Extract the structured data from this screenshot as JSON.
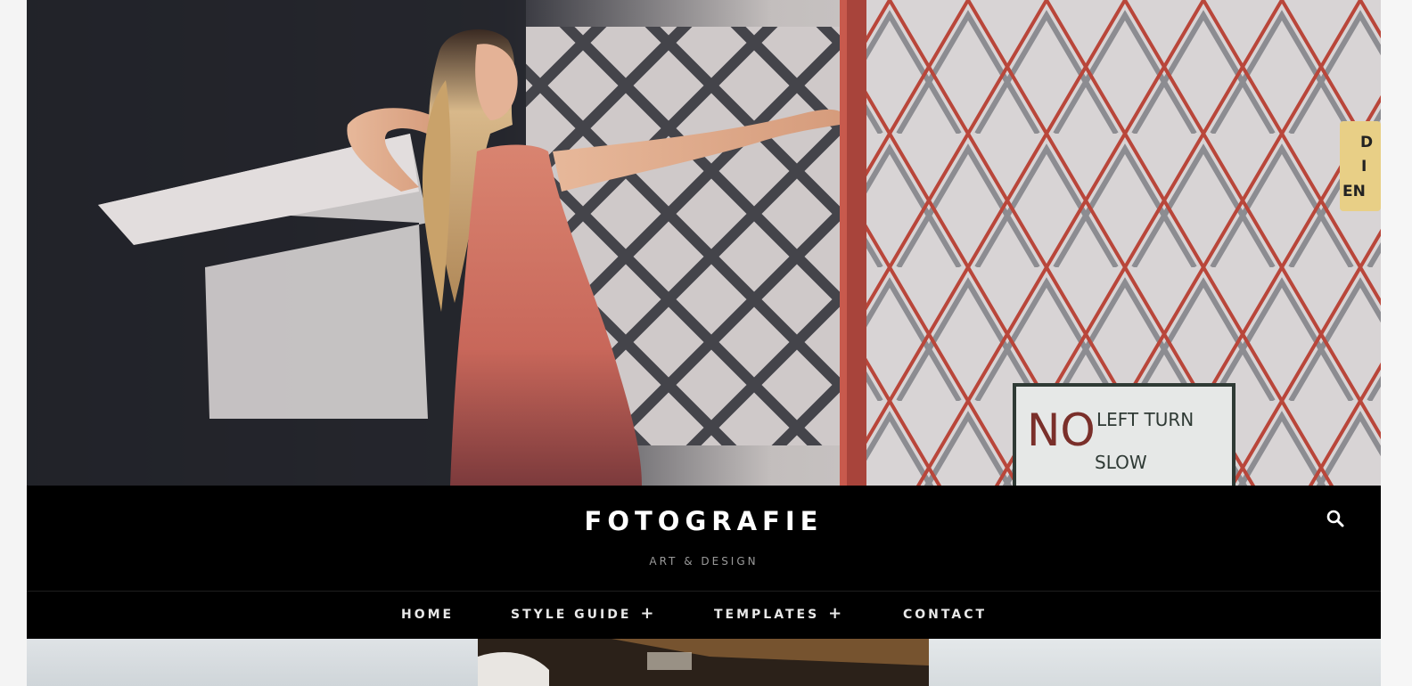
{
  "site": {
    "title": "FOTOGRAFIE",
    "tagline": "ART & DESIGN"
  },
  "nav": {
    "items": [
      {
        "label": "HOME",
        "has_submenu": false
      },
      {
        "label": "STYLE GUIDE",
        "has_submenu": true,
        "indicator": "+"
      },
      {
        "label": "TEMPLATES",
        "has_submenu": true,
        "indicator": "+"
      },
      {
        "label": "CONTACT",
        "has_submenu": false
      }
    ]
  },
  "hero": {
    "sign": {
      "line1_big": "NO",
      "line1_small": "LEFT TURN",
      "line2": "SLOW"
    },
    "edge_sign_text": "D\nI\nEN"
  },
  "icons": {
    "search": "search-icon",
    "plus": "plus-icon"
  },
  "colors": {
    "header_bg": "#000000",
    "title": "#ffffff",
    "tagline": "#9a9a9a",
    "nav_text": "#e8e8e8",
    "page_bg": "#f4f4f4",
    "gate_red": "#b4473a",
    "dress": "#c9695a"
  }
}
